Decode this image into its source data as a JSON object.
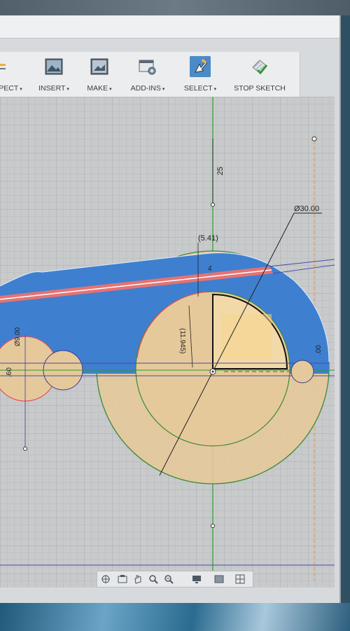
{
  "toolbar": {
    "items": [
      {
        "label": "PECT",
        "icon": "inspect-icon"
      },
      {
        "label": "INSERT",
        "icon": "insert-image-icon"
      },
      {
        "label": "MAKE",
        "icon": "make-icon"
      },
      {
        "label": "ADD-INS",
        "icon": "add-ins-icon"
      },
      {
        "label": "SELECT",
        "icon": "select-cursor-icon"
      },
      {
        "label": "STOP SKETCH",
        "icon": "stop-sketch-icon"
      }
    ],
    "caret": "▾"
  },
  "sketch": {
    "dim_top": "25",
    "dim_diameter": "Ø30.00",
    "dim_541": "(5.41)",
    "dim_11945": "(11.945)",
    "dim_left_9": "Ø9.00",
    "dim_left_60": ".60",
    "dim_right_00": ".00",
    "dim_small_4": "4"
  },
  "colors": {
    "profile_blue": "#3f7fd0",
    "profile_tan": "#e6c99a",
    "sketch_green": "#3a8a3a",
    "highlight_red": "#e0545a",
    "axis_green": "#2f9a2f",
    "construction_orange": "#e8913a"
  }
}
